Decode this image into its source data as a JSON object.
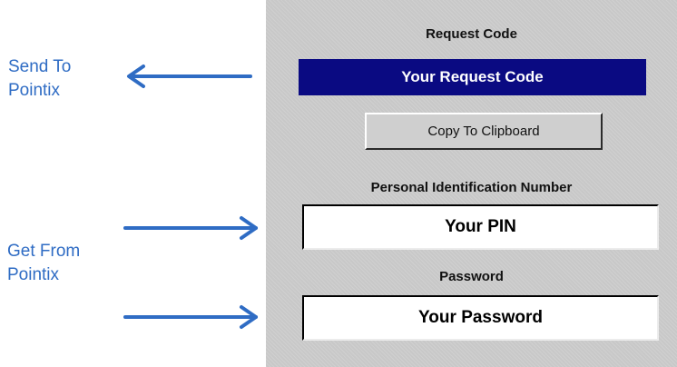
{
  "annotations": {
    "send": {
      "line1": "Send To",
      "line2": "Pointix"
    },
    "get": {
      "line1": "Get From",
      "line2": "Pointix"
    },
    "arrow_color": "#2f6cc4"
  },
  "panel": {
    "request_code_heading": "Request Code",
    "request_code_value": "Your Request Code",
    "copy_button_label": "Copy To Clipboard",
    "pin_heading": "Personal Identification Number",
    "pin_value": "Your PIN",
    "password_heading": "Password",
    "password_value": "Your Password"
  },
  "colors": {
    "panel_bg": "#c8c8c8",
    "code_bar_bg": "#0a0a82",
    "code_bar_text": "#ffffff"
  }
}
